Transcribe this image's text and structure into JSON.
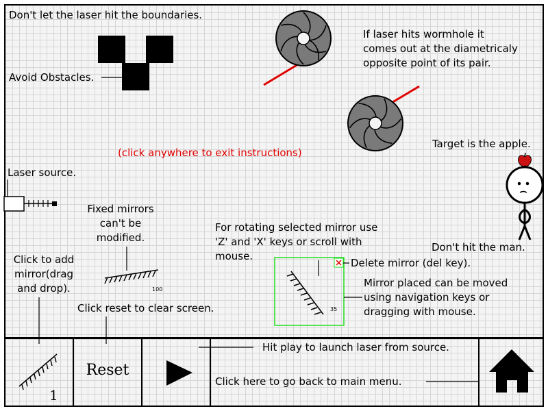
{
  "instructions": {
    "boundaries": "Don't let the laser hit the boundaries.",
    "obstacles": "Avoid Obstacles.",
    "wormhole_1": "If laser hits wormhole it",
    "wormhole_2": "comes out at the diametricaly",
    "wormhole_3": "opposite point of its pair.",
    "exit": "(click anywhere to exit instructions)",
    "target": "Target is the apple.",
    "laser_source": "Laser source.",
    "fixed_1": "Fixed mirrors",
    "fixed_2": "can't be",
    "fixed_3": "modified.",
    "rotate_1": "For rotating selected mirror use",
    "rotate_2": "'Z' and 'X' keys or scroll with",
    "rotate_3": "mouse.",
    "man": "Don't hit the man.",
    "add_1": "Click to add",
    "add_2": "mirror(drag",
    "add_3": "and drop).",
    "delete": "Delete mirror (del key).",
    "move_1": "Mirror placed can be moved",
    "move_2": "using navigation keys or",
    "move_3": "dragging with mouse.",
    "reset": "Click reset to clear screen.",
    "play": "Hit play to launch laser from source.",
    "home": "Click here to go back to main menu."
  },
  "fixed_mirror_angle": "100",
  "selected_mirror_angle": "35",
  "toolbar": {
    "mirror_count": "1",
    "reset_label": "Reset"
  },
  "colors": {
    "laser": "#e00000",
    "wormhole": "#7a7a7a",
    "selection": "#22dd22",
    "apple": "#cc1111",
    "text_hint": "#e00000"
  },
  "icons": {
    "play": "play-icon",
    "home": "home-icon",
    "delete": "delete-x-icon",
    "mirror": "mirror-icon"
  }
}
